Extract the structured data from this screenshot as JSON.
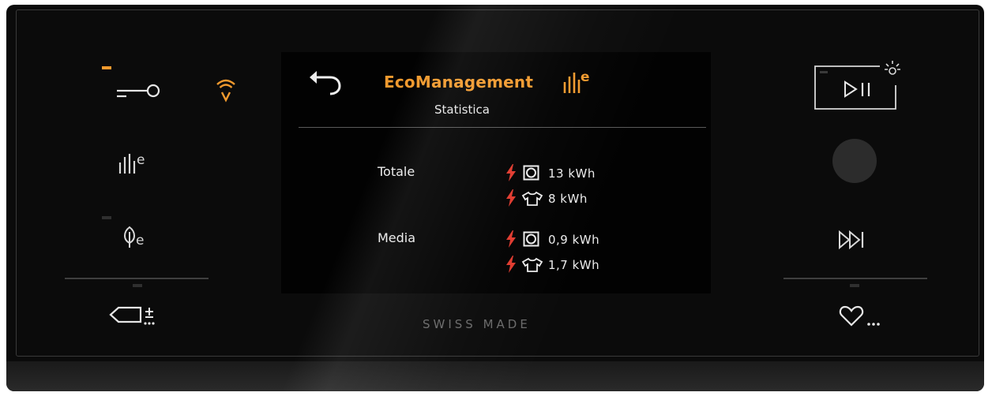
{
  "app": {
    "title": "EcoManagement",
    "subtitle": "Statistica"
  },
  "stats": [
    {
      "label": "Totale",
      "rows": [
        {
          "type": "wash",
          "value": "13 kWh"
        },
        {
          "type": "dry",
          "value": "8 kWh"
        }
      ]
    },
    {
      "label": "Media",
      "rows": [
        {
          "type": "wash",
          "value": "0,9 kWh"
        },
        {
          "type": "dry",
          "value": "1,7 kWh"
        }
      ]
    }
  ],
  "footer": {
    "brand": "SWISS MADE"
  },
  "left_controls": [
    "key-lock-icon",
    "remote-wifi-icon",
    "eco-management-icon",
    "eco-leaf-icon",
    "add-program-tag-icon"
  ],
  "right_controls": [
    "start-pause-icon",
    "round-button-icon",
    "skip-icon",
    "favorites-icon"
  ],
  "colors": {
    "accent": "#f29a2e",
    "bolt": "#e03a2e",
    "text": "#ececec",
    "background": "#0b0b0b"
  }
}
